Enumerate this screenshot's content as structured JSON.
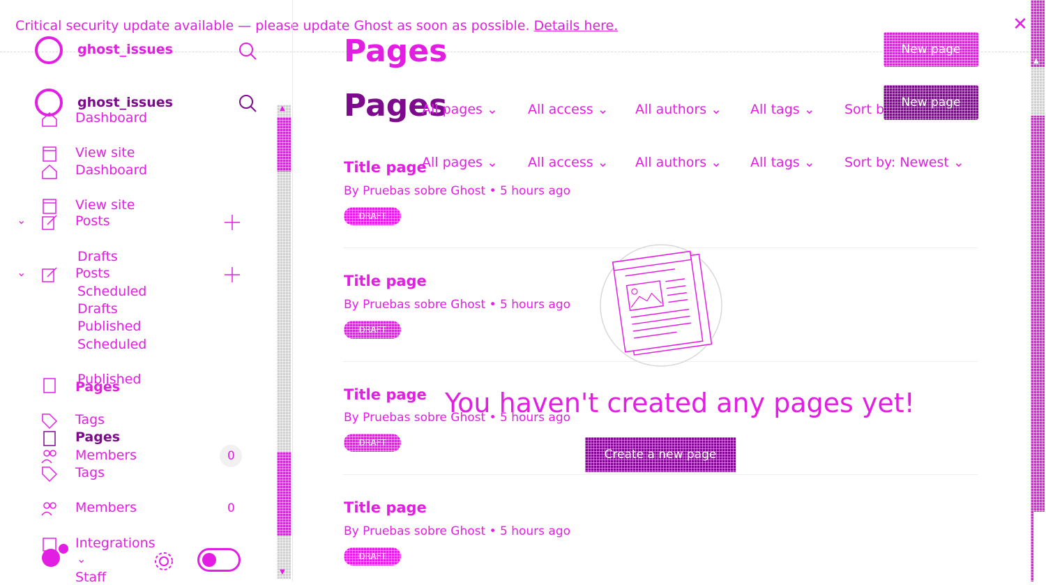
{
  "banner": {
    "message": "Critical security update available — please update Ghost as soon as possible.",
    "link_label": "Details here."
  },
  "sidebar": {
    "site_name": "ghost_issues",
    "nav_ghost": [
      "Dashboard",
      "View site",
      "Posts",
      "Drafts"
    ],
    "nav": {
      "dashboard": "Dashboard",
      "view_site": "View site",
      "posts": "Posts",
      "drafts": "Drafts",
      "scheduled": "Scheduled",
      "published": "Published",
      "pages": "Pages",
      "tags": "Tags",
      "members": "Members",
      "members_count": "0",
      "integrations": "Integrations",
      "staff": "Staff"
    },
    "ghost_extra": {
      "drafts": "Drafts",
      "scheduled": "Scheduled",
      "published": "Published",
      "pages": "Pages",
      "tags": "Tags",
      "members": "Members",
      "members_count": "0"
    }
  },
  "main": {
    "title": "Pages",
    "new_button": "New page",
    "filters": [
      "All pages",
      "All access",
      "All authors",
      "All tags",
      "Sort by: Newest"
    ],
    "ghost_filters": [
      "All pages",
      "All access",
      "All authors",
      "All tags",
      "Sort b"
    ],
    "rows": [
      {
        "title": "Title page",
        "meta": "By Pruebas sobre Ghost • 5 hours ago",
        "badge": "DRAFT"
      },
      {
        "title": "Title page",
        "meta": "By Pruebas sobre Ghost • 5 hours ago",
        "badge": "DRAFT"
      },
      {
        "title": "Title page",
        "meta": "By Pruebas sobre Ghost • 5 hours ago",
        "badge": "DRAFT"
      },
      {
        "title": "Title page",
        "meta": "By Pruebas sobre Ghost • 5 hours ago",
        "badge": "DRAFT"
      }
    ],
    "empty_state": {
      "message": "You haven't created any pages yet!",
      "button": "Create a new page"
    }
  },
  "colors": {
    "accent": "#e31ee3",
    "accent_dark": "#7d0a8d",
    "background": "#ffffff"
  }
}
